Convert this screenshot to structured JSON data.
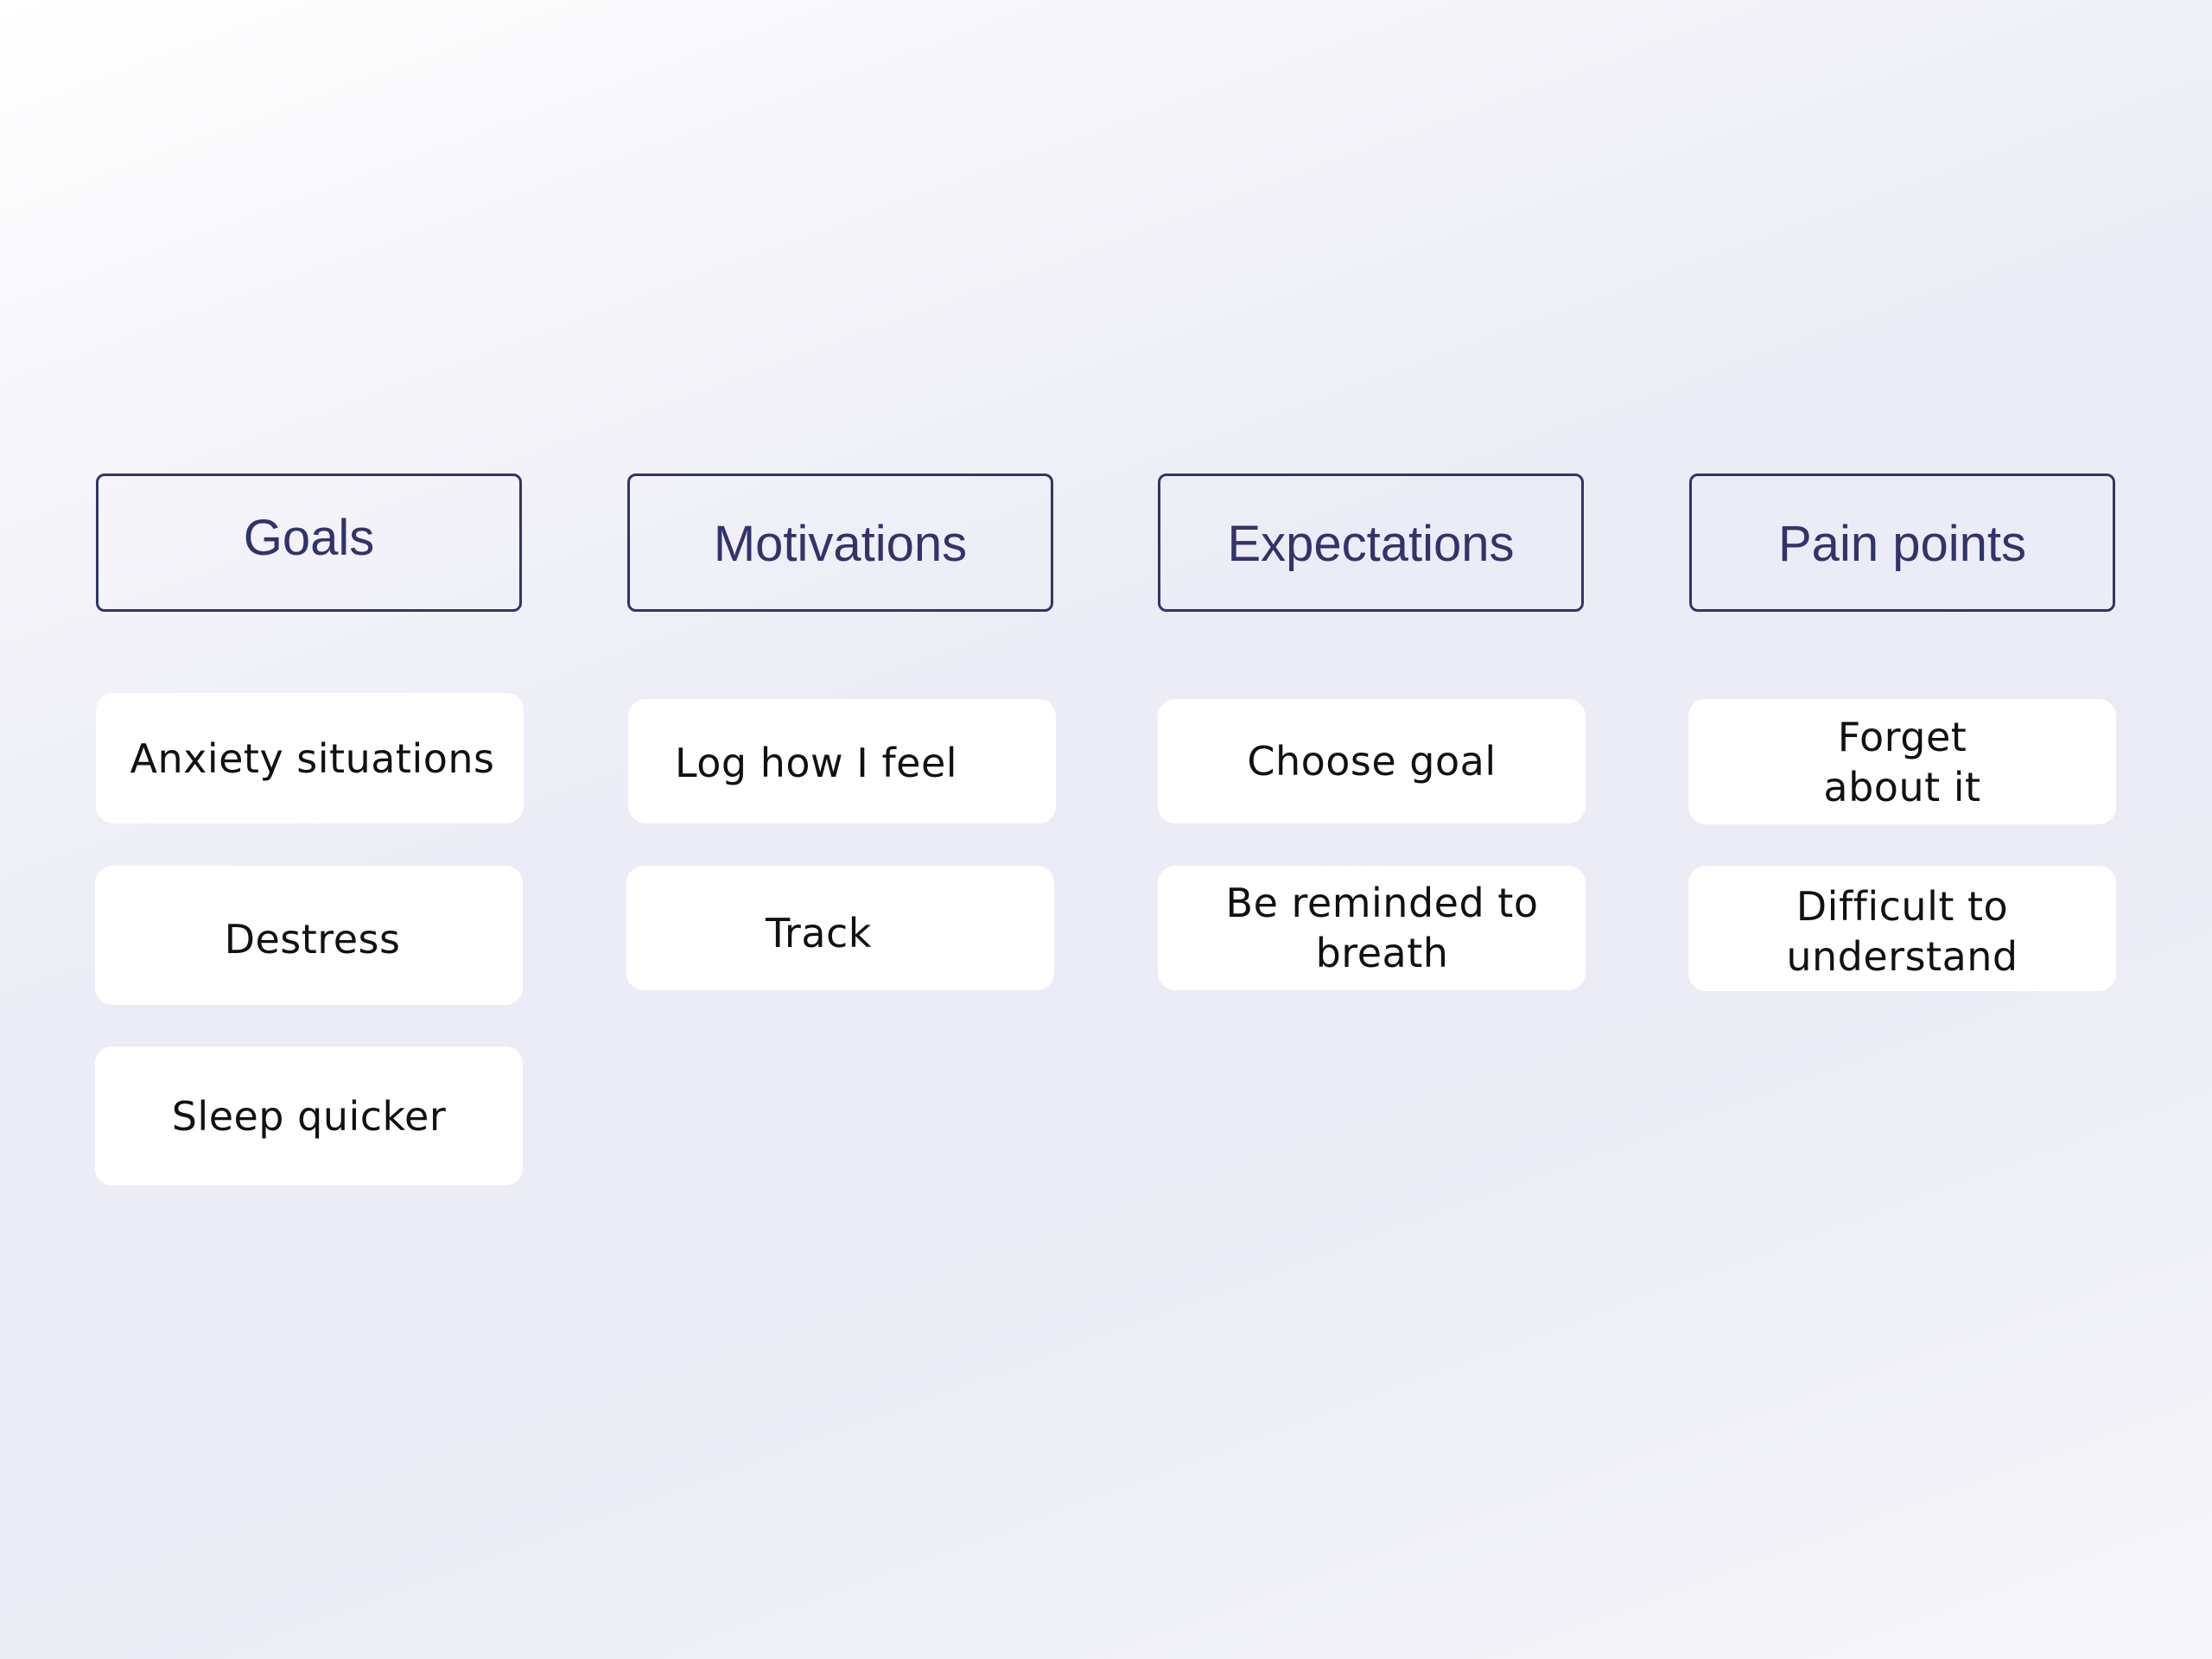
{
  "board": {
    "columns": [
      {
        "header": "Goals",
        "cards": [
          "Anxiety situations",
          "Destress",
          "Sleep quicker"
        ]
      },
      {
        "header": "Motivations",
        "cards": [
          "Log how I feel",
          "Track"
        ]
      },
      {
        "header": "Expectations",
        "cards": [
          "Choose goal",
          "Be reminded to\nbreath"
        ]
      },
      {
        "header": "Pain points",
        "cards": [
          "Forget\nabout it",
          "Difficult to\nunderstand"
        ]
      }
    ]
  },
  "colors": {
    "header_border": "#33336b",
    "header_text": "#33336b",
    "card_background": "#ffffff",
    "card_text": "#111111",
    "background_light": "#ffffff",
    "background_mid": "#ececf6"
  }
}
